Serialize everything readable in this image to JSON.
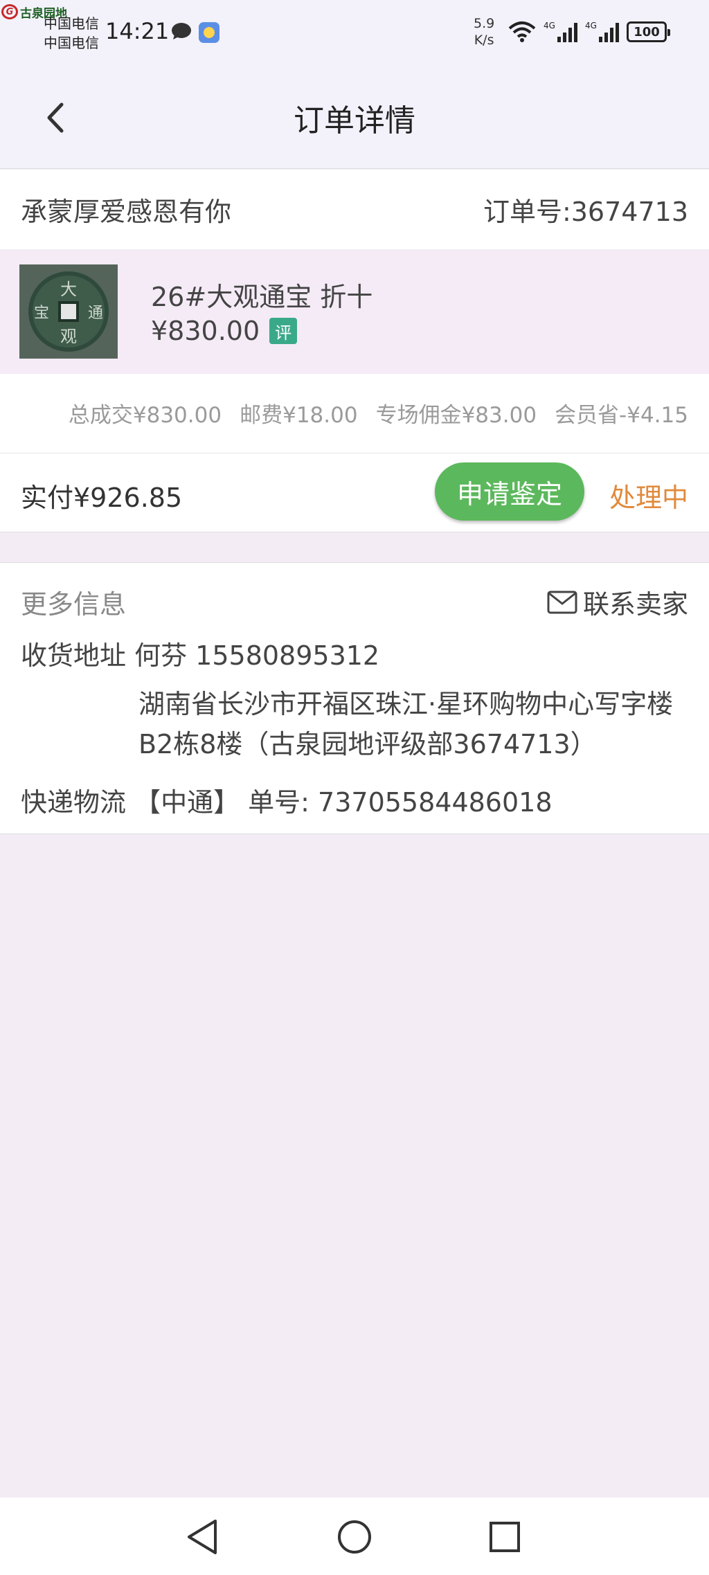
{
  "status_bar": {
    "logo_text": "古泉园地",
    "carrier1": "中国电信",
    "carrier2": "中国电信",
    "time": "14:21",
    "speed_value": "5.9",
    "speed_unit": "K/s",
    "battery": "100"
  },
  "header": {
    "title": "订单详情"
  },
  "order": {
    "greeting": "承蒙厚爱感恩有你",
    "order_number": "订单号:3674713",
    "product": {
      "name": "26#大观通宝 折十",
      "price": "¥830.00",
      "badge": "评"
    },
    "fees": {
      "total": "总成交¥830.00",
      "postage": "邮费¥18.00",
      "commission": "专场佣金¥83.00",
      "member_discount": "会员省-¥4.15"
    },
    "paid": "实付¥926.85",
    "apply_button": "申请鉴定",
    "status": "处理中"
  },
  "more_info": {
    "title": "更多信息",
    "contact_seller": "联系卖家",
    "address_label_line": "收货地址 何芬 15580895312",
    "address_detail": "湖南省长沙市开福区珠江·星环购物中心写字楼B2栋8楼（古泉园地评级部3674713）",
    "express_line": "快递物流 【中通】 单号: 73705584486018"
  },
  "colors": {
    "header_bg": "#f3f2fb",
    "page_bg": "#f3ecf5",
    "apply_button": "#5cb85c",
    "status_text": "#e08a3c",
    "badge": "#3aa98a"
  }
}
